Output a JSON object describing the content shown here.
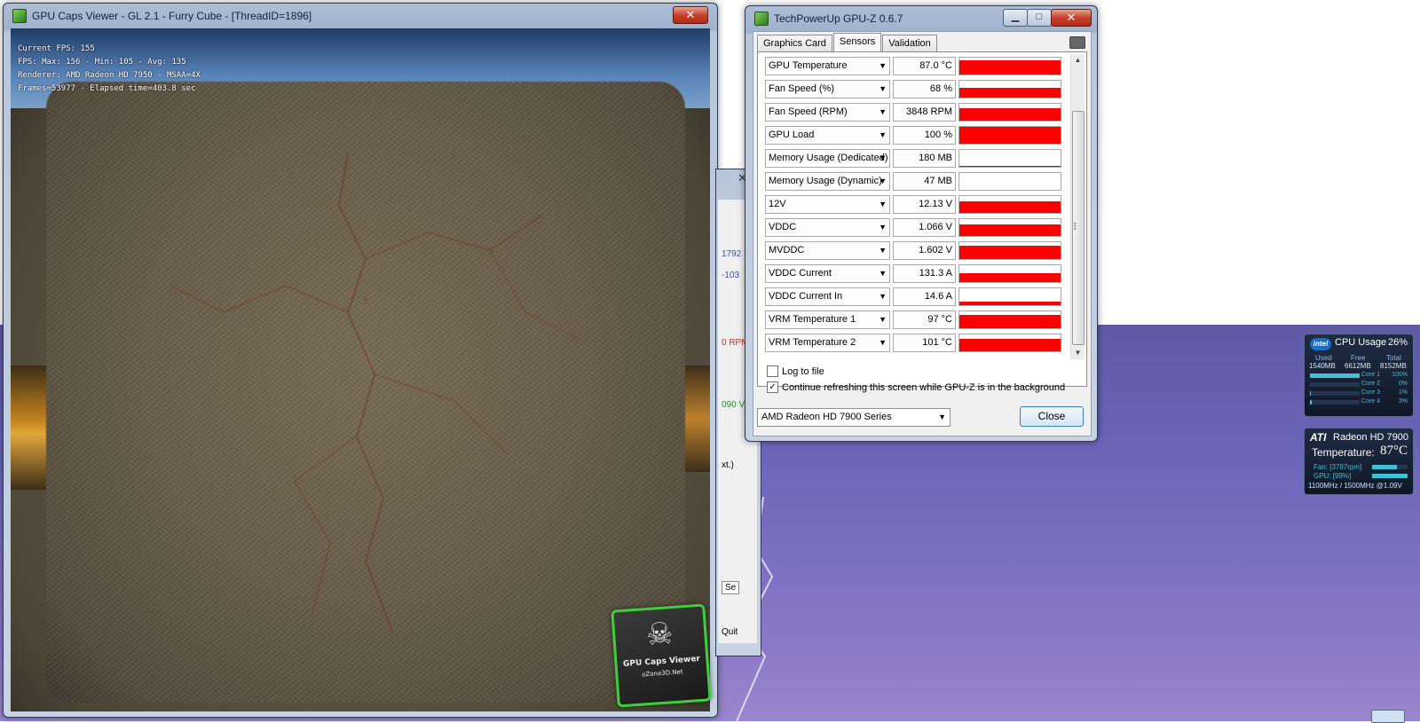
{
  "gcv_window": {
    "title": "GPU Caps Viewer - GL 2.1 - Furry Cube - [ThreadID=1896]",
    "close_label": "✕",
    "hud": {
      "line1": "Current FPS: 155",
      "line2": "FPS: Max: 156 - Min: 105 - Avg: 135",
      "line3": "Renderer: AMD Radeon HD 7950 - MSAA=4X",
      "line4": "Frames=53977 - Elapsed time=403.8 sec"
    },
    "logo": {
      "line1": "GPU Caps Viewer",
      "line2": "oZone3D.Net"
    }
  },
  "behind_window": {
    "close_label": "✕",
    "texts": [
      "1792",
      "-103",
      "0 RPM",
      "090 V",
      "xt.)",
      "Se",
      "Quit"
    ]
  },
  "gpuz": {
    "title": "TechPowerUp GPU-Z 0.6.7",
    "tabs": [
      "Graphics Card",
      "Sensors",
      "Validation"
    ],
    "active_tab": "Sensors",
    "sensors": [
      {
        "name": "GPU Temperature",
        "value": "87.0 °C",
        "level": 0.85
      },
      {
        "name": "Fan Speed (%)",
        "value": "68 %",
        "level": 0.6
      },
      {
        "name": "Fan Speed (RPM)",
        "value": "3848 RPM",
        "level": 0.75
      },
      {
        "name": "GPU Load",
        "value": "100 %",
        "level": 1.0
      },
      {
        "name": "Memory Usage (Dedicated)",
        "value": "180 MB",
        "level": 0.05
      },
      {
        "name": "Memory Usage (Dynamic)",
        "value": "47 MB",
        "level": 0.0
      },
      {
        "name": "12V",
        "value": "12.13 V",
        "level": 0.7
      },
      {
        "name": "VDDC",
        "value": "1.066 V",
        "level": 0.7
      },
      {
        "name": "MVDDC",
        "value": "1.602 V",
        "level": 0.8
      },
      {
        "name": "VDDC Current",
        "value": "131.3 A",
        "level": 0.55
      },
      {
        "name": "VDDC Current In",
        "value": "14.6 A",
        "level": 0.2
      },
      {
        "name": "VRM Temperature 1",
        "value": "97 °C",
        "level": 0.8
      },
      {
        "name": "VRM Temperature 2",
        "value": "101 °C",
        "level": 0.75
      }
    ],
    "log_to_file": {
      "label": "Log to file",
      "checked": false
    },
    "continue_refresh": {
      "label": "Continue refreshing this screen while GPU-Z is in the background",
      "checked": true
    },
    "gpu_select": "AMD Radeon HD 7900 Series",
    "close_button": "Close",
    "graph_color": "#ff0000"
  },
  "cpu_gadget": {
    "brand": "intel",
    "title": "CPU Usage",
    "percent": "26%",
    "headers": [
      "Used",
      "Free",
      "Total"
    ],
    "values": [
      "1540MB",
      "6612MB",
      "8152MB"
    ],
    "cores": [
      {
        "label": "Core 1",
        "value": "100%",
        "level": 1.0
      },
      {
        "label": "Core 2",
        "value": "0%",
        "level": 0.0
      },
      {
        "label": "Core 3",
        "value": "1%",
        "level": 0.01
      },
      {
        "label": "Core 4",
        "value": "3%",
        "level": 0.03
      }
    ]
  },
  "gpu_gadget": {
    "brand": "ATI",
    "title": "Radeon HD 7900",
    "temp_label": "Temperature:",
    "temp_value": "87°C",
    "fan": "Fan: [3797rpm]",
    "gpu": "GPU: [99%]",
    "fan_level": 0.7,
    "gpu_level": 0.99,
    "clocks": "1100MHz / 1500MHz @1.09V"
  }
}
